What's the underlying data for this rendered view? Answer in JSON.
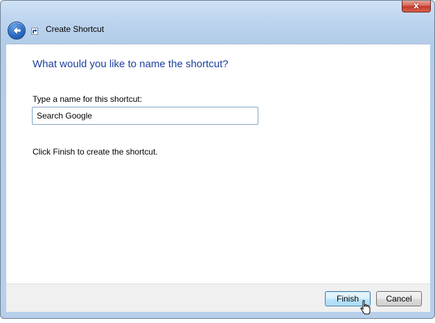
{
  "window": {
    "title": "Create Shortcut",
    "close_glyph": "x"
  },
  "icons": {
    "back": "back-arrow-icon",
    "shortcut": "shortcut-arrow-icon",
    "cursor": "hand-pointer-cursor-icon"
  },
  "content": {
    "heading": "What would you like to name the shortcut?",
    "field_label": "Type a name for this shortcut:",
    "name_value": "Search Google",
    "info": "Click Finish to create the shortcut."
  },
  "buttons": {
    "finish_label": "Finish",
    "cancel_label": "Cancel"
  },
  "colors": {
    "heading": "#1b3f9c",
    "finish_border": "#3c7fb1",
    "close_red": "#c4382a"
  }
}
